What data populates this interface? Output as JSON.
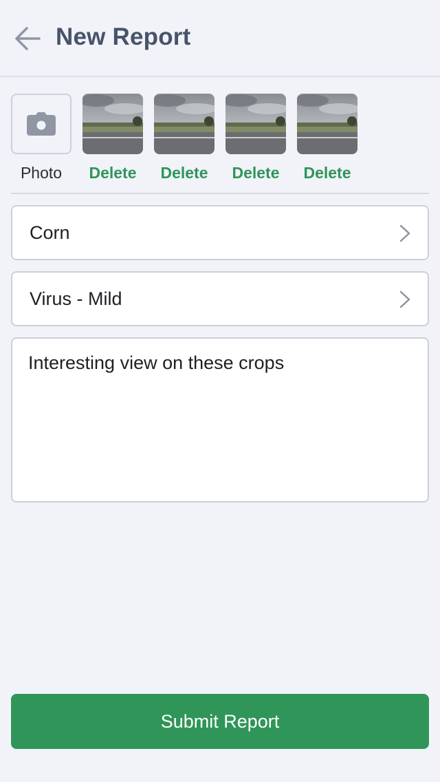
{
  "header": {
    "title": "New Report",
    "back_icon": "arrow-left-icon"
  },
  "photos": {
    "add_label": "Photo",
    "add_icon": "camera-icon",
    "items": [
      {
        "delete_label": "Delete"
      },
      {
        "delete_label": "Delete"
      },
      {
        "delete_label": "Delete"
      },
      {
        "delete_label": "Delete"
      }
    ]
  },
  "form": {
    "crop": {
      "value": "Corn",
      "icon": "chevron-right-icon"
    },
    "issue": {
      "value": "Virus - Mild",
      "icon": "chevron-right-icon"
    },
    "notes": {
      "value": "Interesting view on these crops"
    }
  },
  "submit_label": "Submit Report",
  "colors": {
    "accent": "#2f9558",
    "background": "#f1f3f9",
    "title": "#48536a"
  }
}
